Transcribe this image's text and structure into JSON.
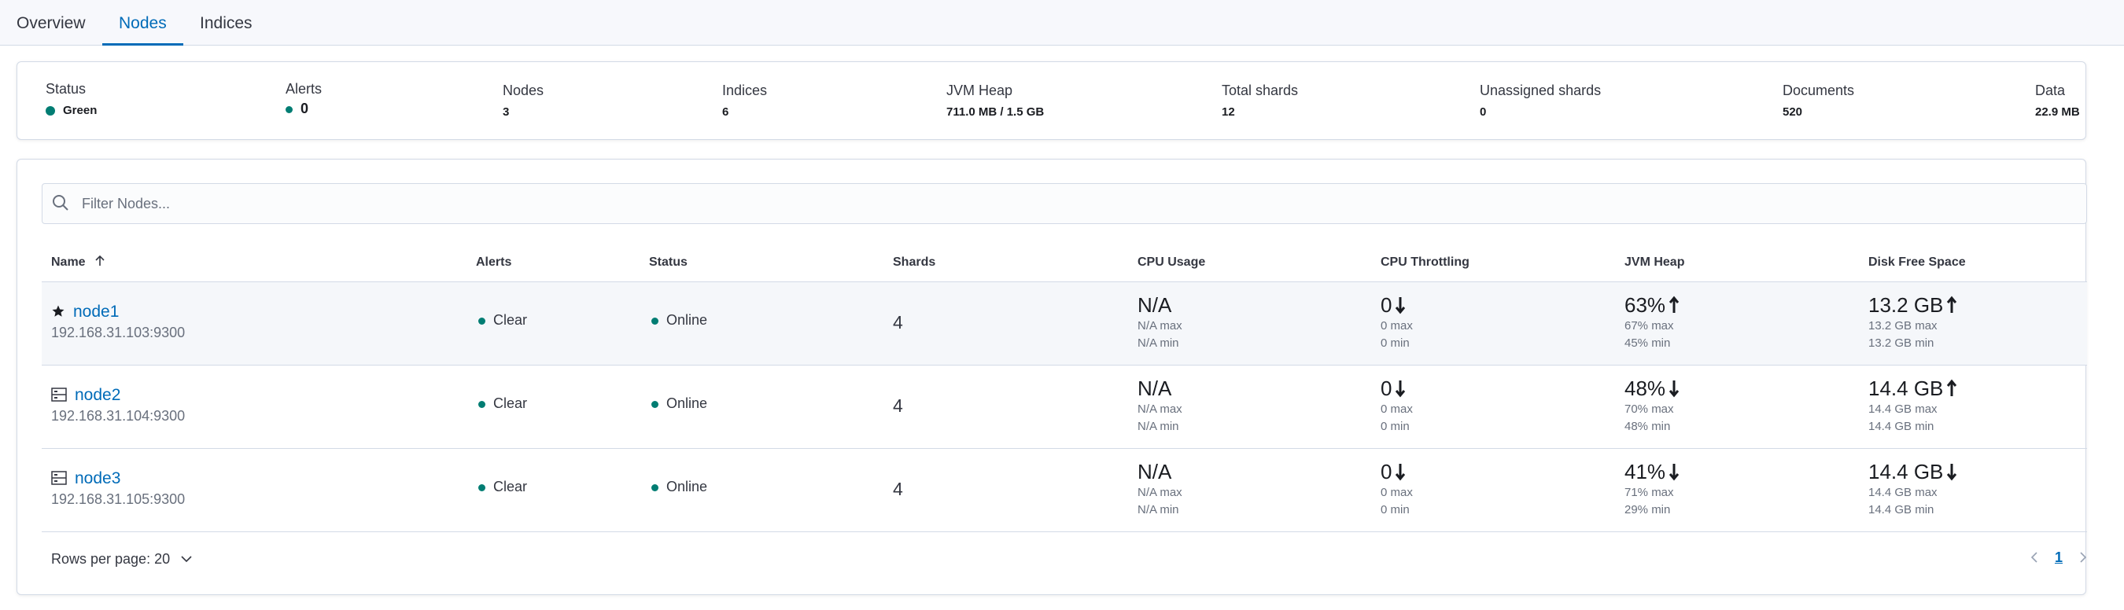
{
  "tabs": [
    {
      "label": "Overview"
    },
    {
      "label": "Nodes"
    },
    {
      "label": "Indices"
    }
  ],
  "summary": {
    "status": {
      "label": "Status",
      "value": "Green",
      "color": "#017d73"
    },
    "alerts": {
      "label": "Alerts",
      "value": "0"
    },
    "nodes": {
      "label": "Nodes",
      "value": "3"
    },
    "indices": {
      "label": "Indices",
      "value": "6"
    },
    "jvm_heap": {
      "label": "JVM Heap",
      "value": "711.0 MB / 1.5 GB"
    },
    "total_shards": {
      "label": "Total shards",
      "value": "12"
    },
    "unassigned_shards": {
      "label": "Unassigned shards",
      "value": "0"
    },
    "documents": {
      "label": "Documents",
      "value": "520"
    },
    "data": {
      "label": "Data",
      "value": "22.9 MB"
    }
  },
  "filter": {
    "placeholder": "Filter Nodes..."
  },
  "columns": {
    "name": "Name",
    "alerts": "Alerts",
    "status": "Status",
    "shards": "Shards",
    "cpu_usage": "CPU Usage",
    "cpu_throttling": "CPU Throttling",
    "jvm_heap": "JVM Heap",
    "disk_free": "Disk Free Space"
  },
  "rows": [
    {
      "icon": "star-icon",
      "name": "node1",
      "ip": "192.168.31.103:9300",
      "alerts": "Clear",
      "status": "Online",
      "shards": "4",
      "cpu": {
        "value": "N/A",
        "max": "N/A max",
        "min": "N/A min"
      },
      "throttling": {
        "value": "0",
        "trend": "down",
        "max": "0 max",
        "min": "0 min"
      },
      "jvm": {
        "value": "63%",
        "trend": "up",
        "max": "67% max",
        "min": "45% min"
      },
      "disk": {
        "value": "13.2 GB",
        "trend": "up",
        "max": "13.2 GB max",
        "min": "13.2 GB min"
      }
    },
    {
      "icon": "server-icon",
      "name": "node2",
      "ip": "192.168.31.104:9300",
      "alerts": "Clear",
      "status": "Online",
      "shards": "4",
      "cpu": {
        "value": "N/A",
        "max": "N/A max",
        "min": "N/A min"
      },
      "throttling": {
        "value": "0",
        "trend": "down",
        "max": "0 max",
        "min": "0 min"
      },
      "jvm": {
        "value": "48%",
        "trend": "down",
        "max": "70% max",
        "min": "48% min"
      },
      "disk": {
        "value": "14.4 GB",
        "trend": "up",
        "max": "14.4 GB max",
        "min": "14.4 GB min"
      }
    },
    {
      "icon": "server-icon",
      "name": "node3",
      "ip": "192.168.31.105:9300",
      "alerts": "Clear",
      "status": "Online",
      "shards": "4",
      "cpu": {
        "value": "N/A",
        "max": "N/A max",
        "min": "N/A min"
      },
      "throttling": {
        "value": "0",
        "trend": "down",
        "max": "0 max",
        "min": "0 min"
      },
      "jvm": {
        "value": "41%",
        "trend": "down",
        "max": "71% max",
        "min": "29% min"
      },
      "disk": {
        "value": "14.4 GB",
        "trend": "down",
        "max": "14.4 GB max",
        "min": "14.4 GB min"
      }
    }
  ],
  "footer": {
    "rows_per_page": "Rows per page: 20",
    "page": "1"
  },
  "colors": {
    "accent": "#006bb8",
    "success": "#017d73"
  }
}
